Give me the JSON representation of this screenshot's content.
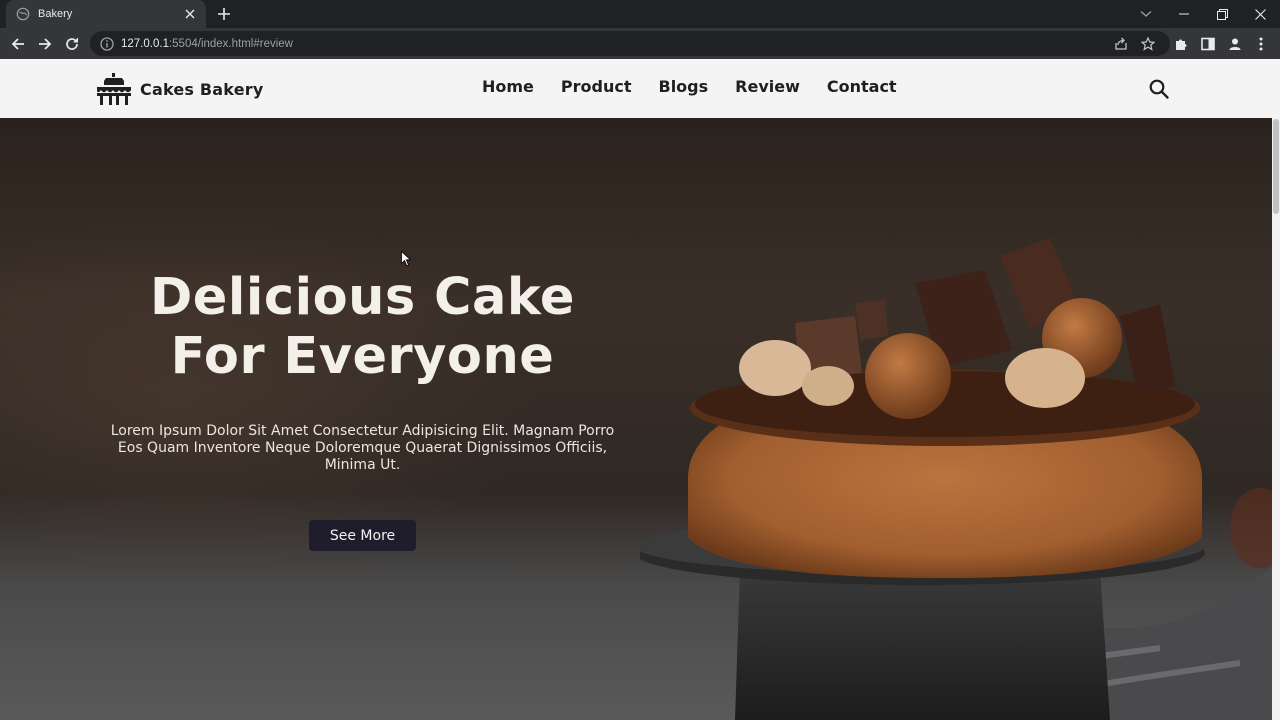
{
  "browser": {
    "tab_title": "Bakery",
    "url_host": "127.0.0.1",
    "url_rest": ":5504/index.html#review"
  },
  "site": {
    "brand": "Cakes Bakery",
    "nav": [
      "Home",
      "Product",
      "Blogs",
      "Review",
      "Contact"
    ]
  },
  "hero": {
    "title_line1": "Delicious Cake",
    "title_line2": "For Everyone",
    "description": "Lorem Ipsum Dolor Sit Amet Consectetur Adipisicing Elit. Magnam Porro Eos Quam Inventore Neque Doloremque Quaerat Dignissimos Officiis, Minima Ut.",
    "cta_label": "See More"
  },
  "icons": {
    "favicon": "globe-icon",
    "close": "close-icon",
    "new_tab": "plus-icon",
    "search": "search-icon",
    "logo": "cake-icon"
  },
  "colors": {
    "header_bg": "#f4f4f4",
    "cta_bg": "#1f1c2b",
    "hero_text": "#f3efe9"
  }
}
